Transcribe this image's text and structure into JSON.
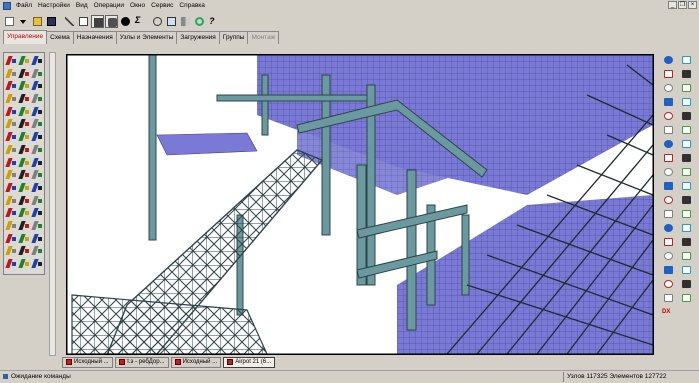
{
  "menu": [
    "Файл",
    "Настройки",
    "Вид",
    "Операции",
    "Окно",
    "Сервис",
    "Справка"
  ],
  "tabs": [
    {
      "label": "Управление",
      "state": "active"
    },
    {
      "label": "Схема",
      "state": "normal"
    },
    {
      "label": "Назначения",
      "state": "normal"
    },
    {
      "label": "Узлы и Элементы",
      "state": "normal"
    },
    {
      "label": "Загружения",
      "state": "normal"
    },
    {
      "label": "Группы",
      "state": "normal"
    },
    {
      "label": "Монтаж",
      "state": "disabled"
    }
  ],
  "taskbar": [
    {
      "label": "Исходный ...",
      "active": false
    },
    {
      "label": "т.э - ребДор...",
      "active": false
    },
    {
      "label": "Исходный ...",
      "active": false
    },
    {
      "label": "Airpot 21 (6...",
      "active": true
    }
  ],
  "status": {
    "left": "Ожидание команды",
    "right": "Узлов 117325 Элементов 127722"
  },
  "right_tools_label": "DX",
  "colors": {
    "slab": "#7a7ad6",
    "structure": "#5e8c90",
    "active_tab": "#c00000",
    "background": "#d4d0c8"
  }
}
